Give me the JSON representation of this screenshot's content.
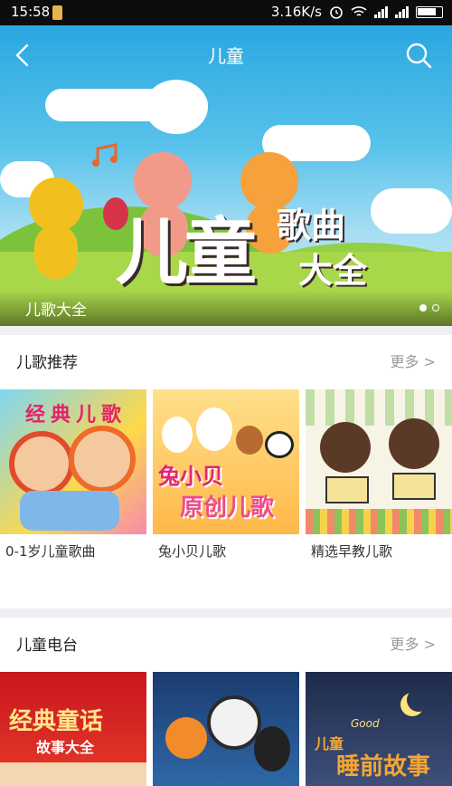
{
  "status_bar": {
    "time": "15:58",
    "net_speed": "3.16K/s"
  },
  "nav": {
    "title": "儿童",
    "back_icon": "chevron-left-icon",
    "search_icon": "search-icon"
  },
  "banner": {
    "caption": "儿歌大全",
    "art_title": "儿童",
    "art_sub_1": "歌曲",
    "art_sub_2": "大全",
    "page_count": 2,
    "active_page": 1
  },
  "sections": [
    {
      "title": "儿歌推荐",
      "more": "更多 >",
      "items": [
        {
          "label": "0-1岁儿童歌曲",
          "art_text": "经典儿歌"
        },
        {
          "label": "兔小贝儿歌",
          "art_text_1": "兔小贝",
          "art_text_2": "原创儿歌"
        },
        {
          "label": "精选早教儿歌"
        }
      ]
    },
    {
      "title": "儿童电台",
      "more": "更多 >",
      "items": [
        {
          "art_text_1": "经典童话",
          "art_text_2": "故事大全"
        },
        {},
        {
          "art_text_1": "儿童",
          "art_text_2": "睡前故事",
          "art_text_3": "Good"
        }
      ]
    }
  ],
  "colors": {
    "header_blue": "#2aa7e0",
    "divider": "#efeff4",
    "more_gray": "#9a9a9a"
  }
}
